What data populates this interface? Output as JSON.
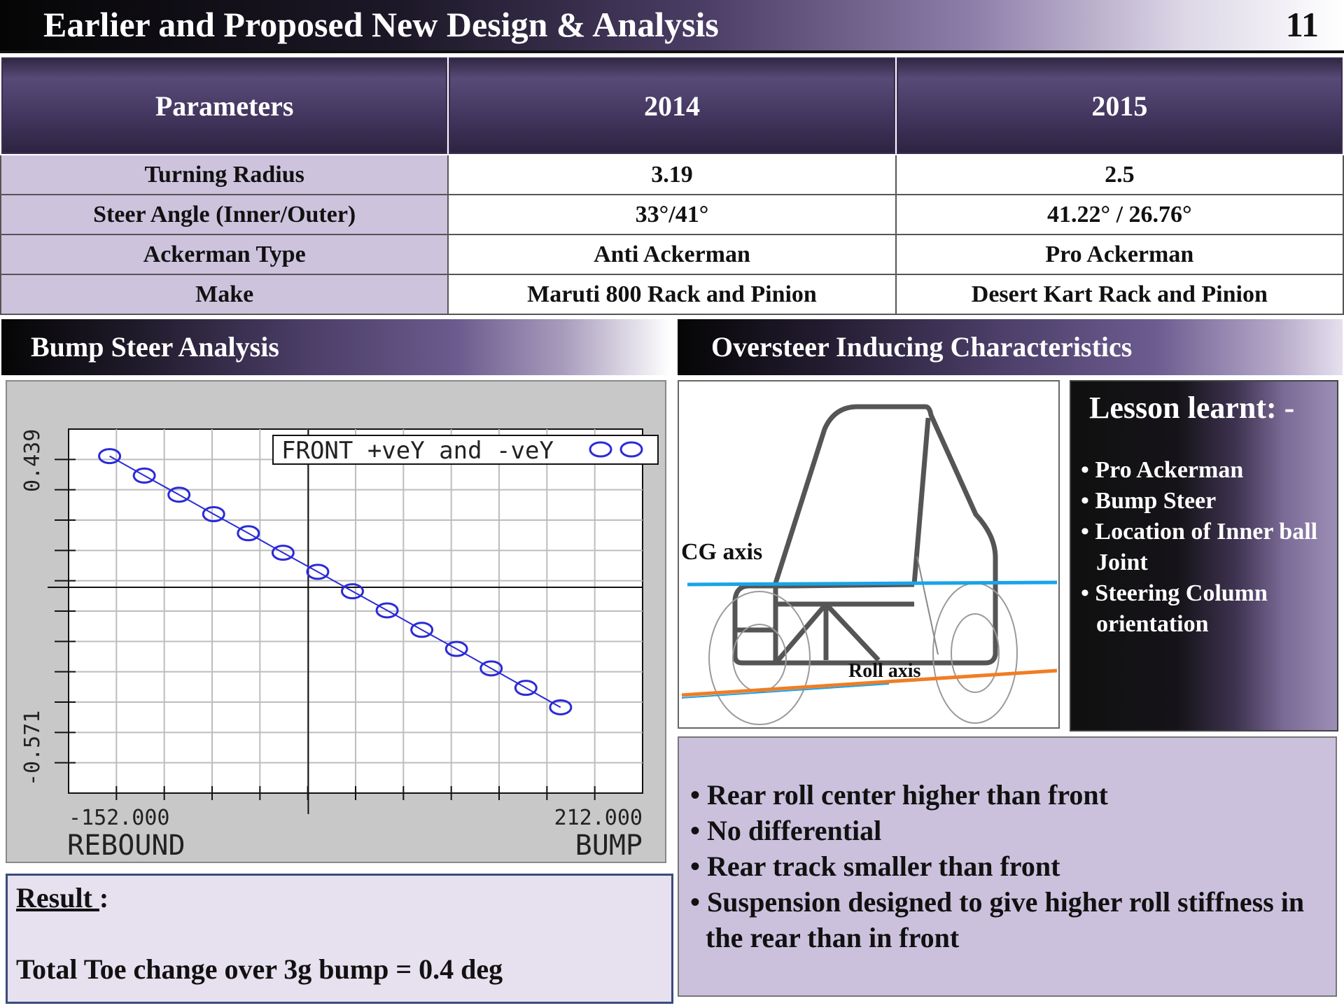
{
  "title": "Earlier and Proposed New Design  & Analysis",
  "slide_number": "11",
  "table": {
    "headers": [
      "Parameters",
      "2014",
      "2015"
    ],
    "rows": [
      [
        "Turning Radius",
        "3.19",
        "2.5"
      ],
      [
        "Steer Angle (Inner/Outer)",
        "33°/41°",
        "41.22° /  26.76°"
      ],
      [
        "Ackerman  Type",
        "Anti Ackerman",
        "Pro Ackerman"
      ],
      [
        "Make",
        "Maruti 800 Rack and Pinion",
        "Desert Kart Rack and Pinion"
      ]
    ]
  },
  "bump_steer": {
    "header": "Bump Steer Analysis",
    "chart_data": {
      "type": "line",
      "legend": "FRONT +veY and -veY",
      "legend_position": "top-right",
      "ylim_labels": [
        "0.439",
        "-0.571"
      ],
      "xlim_labels": [
        "-152.000",
        "212.000"
      ],
      "xlabel_left": "REBOUND",
      "xlabel_right": "BUMP",
      "grid": true,
      "ylim": [
        -0.571,
        0.439
      ],
      "xlim": [
        -152,
        212
      ],
      "x": [
        -126,
        -104,
        -82,
        -60,
        -38,
        -16,
        6,
        28,
        50,
        72,
        94,
        116,
        138,
        160
      ],
      "y": [
        0.364,
        0.31,
        0.257,
        0.203,
        0.15,
        0.096,
        0.043,
        -0.011,
        -0.064,
        -0.118,
        -0.171,
        -0.225,
        -0.279,
        -0.333
      ],
      "series_color": "#2a2ad8"
    },
    "result_label": "Result ",
    "result_colon": ":",
    "result_text": "Total Toe change over 3g bump = 0.4 deg"
  },
  "oversteer": {
    "header": "Oversteer Inducing Characteristics",
    "image_labels": {
      "cg_axis": "CG  axis",
      "roll_axis": "Roll axis"
    },
    "lesson_title": "Lesson learnt: -",
    "lesson_items": [
      "Pro Ackerman",
      "Bump Steer",
      "Location of Inner ball Joint",
      "Steering Column orientation"
    ],
    "characteristics": [
      "Rear roll center higher than front",
      "No differential",
      "Rear track smaller than front",
      "Suspension designed to give higher roll stiffness in the rear than  in front"
    ]
  },
  "colors": {
    "header_purple": "#43375f",
    "param_cell": "#cdc3dd",
    "char_box": "#cbc1dd",
    "cg_axis_line": "#1aa3e8",
    "roll_axis_line": "#f07d24"
  }
}
